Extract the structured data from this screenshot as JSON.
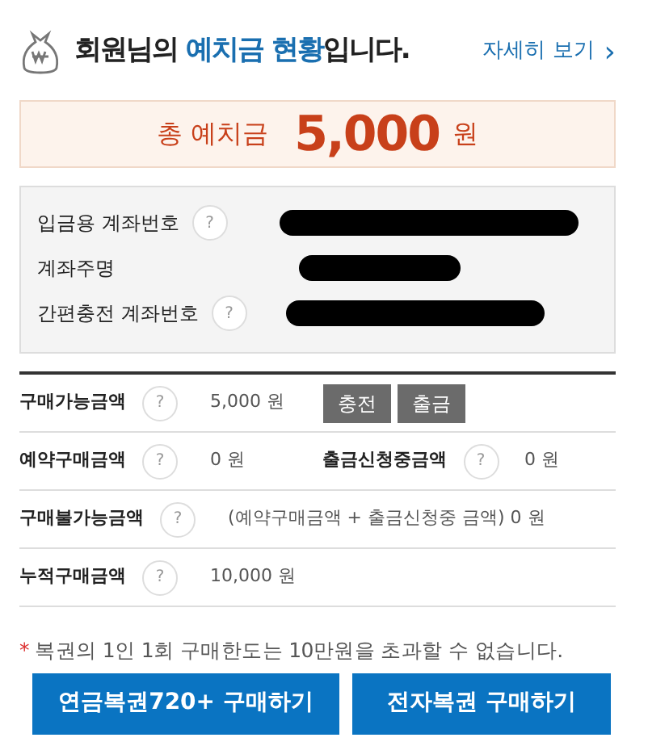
{
  "header": {
    "title_parts": [
      {
        "text": "회원님의 ",
        "highlight": false
      },
      {
        "text": "예치금 현황",
        "highlight": true
      },
      {
        "text": "입니다.",
        "highlight": false
      }
    ],
    "more_link": "자세히 보기",
    "more_arrow": "›"
  },
  "total": {
    "label": "총 예치금",
    "amount": "5,000",
    "unit": "원"
  },
  "accounts": [
    {
      "label": "입금용 계좌번호",
      "help": "?",
      "redacted": true
    },
    {
      "label": "계좌주명",
      "redacted": true
    },
    {
      "label": "간편충전 계좌번호",
      "help": "?",
      "redacted": true
    }
  ],
  "details": [
    {
      "label": "구매가능금액",
      "help": "?",
      "value": "5,000 원",
      "buttons": [
        "충전",
        "출금"
      ]
    },
    {
      "label": "예약구매금액",
      "help": "?",
      "value": "0 원",
      "second": {
        "label": "출금신청중금액",
        "help": "?",
        "value": "0 원"
      }
    },
    {
      "label": "구매불가능금액",
      "help": "?",
      "value": "(예약구매금액 + 출금신청중 금액)  0 원"
    },
    {
      "label": "누적구매금액",
      "help": "?",
      "value": "10,000 원"
    }
  ],
  "notice": {
    "mark": "*",
    "text": "복권의 1인 1회 구매한도는 10만원을 초과할 수 없습니다."
  },
  "actions": [
    "연금복권720+ 구매하기",
    "전자복권 구매하기"
  ]
}
